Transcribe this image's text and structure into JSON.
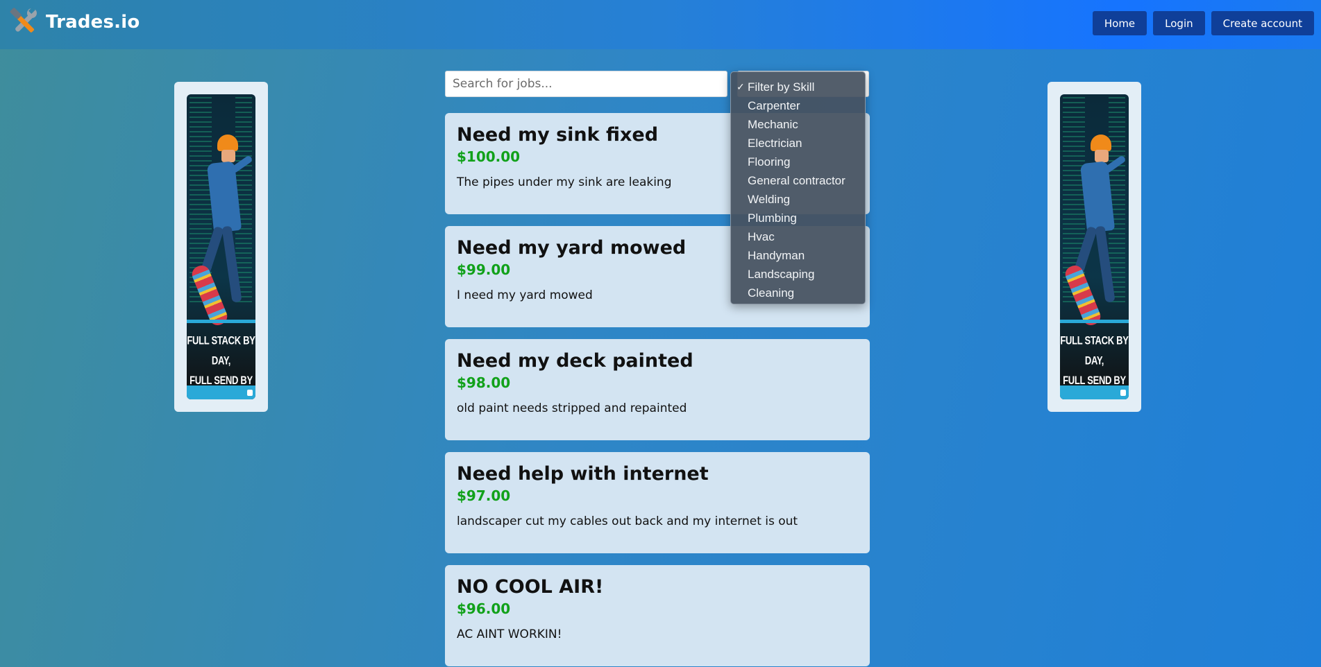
{
  "header": {
    "brand": "Trades.io",
    "logo_icon": "tools-icon",
    "nav": [
      {
        "label": "Home"
      },
      {
        "label": "Login"
      },
      {
        "label": "Create account"
      }
    ]
  },
  "ads": {
    "tagline_line1": "FULL STACK BY DAY,",
    "tagline_line2": "FULL SEND BY NIGHT"
  },
  "search": {
    "placeholder": "Search for jobs...",
    "value": ""
  },
  "filter": {
    "selected": "Filter by Skill",
    "options": [
      "Filter by Skill",
      "Carpenter",
      "Mechanic",
      "Electrician",
      "Flooring",
      "General contractor",
      "Welding",
      "Plumbing",
      "Hvac",
      "Handyman",
      "Landscaping",
      "Cleaning"
    ]
  },
  "jobs": [
    {
      "title": "Need my sink fixed",
      "price": "$100.00",
      "description": "The pipes under my sink are leaking"
    },
    {
      "title": "Need my yard mowed",
      "price": "$99.00",
      "description": "I need my yard mowed"
    },
    {
      "title": "Need my deck painted",
      "price": "$98.00",
      "description": "old paint needs stripped and repainted"
    },
    {
      "title": "Need help with internet",
      "price": "$97.00",
      "description": "landscaper cut my cables out back and my internet is out"
    },
    {
      "title": "NO COOL AIR!",
      "price": "$96.00",
      "description": "AC AINT WORKIN!"
    }
  ],
  "colors": {
    "accent": "#0f3f99",
    "price": "#11a11a",
    "card": "#d3e4f2"
  }
}
